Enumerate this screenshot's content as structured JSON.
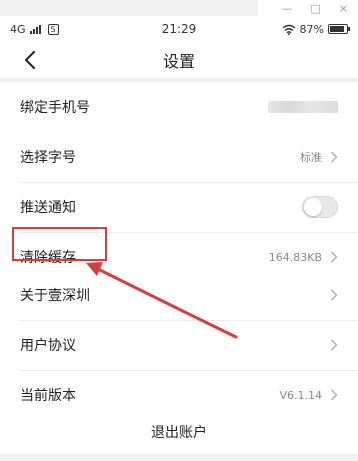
{
  "window_controls": {
    "minimize": "—",
    "maximize": "□",
    "close": "×"
  },
  "status_bar": {
    "network": "4G",
    "sim_icon_label": "S",
    "time": "21:29",
    "battery_text": "87%",
    "battery_level": 0.87
  },
  "header": {
    "back_icon": "chevron-left-icon",
    "title": "设置"
  },
  "groups": {
    "account": [
      {
        "label": "绑定手机号",
        "value": ""
      }
    ],
    "settings": [
      {
        "label": "选择字号",
        "value": "标准"
      },
      {
        "label": "推送通知",
        "toggle_on": false
      },
      {
        "label": "清除缓存",
        "value": "164.83KB"
      }
    ],
    "about": [
      {
        "label": "关于壹深圳",
        "value": ""
      },
      {
        "label": "用户协议",
        "value": ""
      },
      {
        "label": "当前版本",
        "value": "V6.1.14"
      }
    ]
  },
  "logout": {
    "label": "退出账户"
  },
  "annotation": {
    "highlight_color": "#d93c3c",
    "arrow_color": "#d93c3c"
  },
  "colors": {
    "background": "#f2f2f2",
    "panel": "#ffffff",
    "divider": "#ececec"
  }
}
